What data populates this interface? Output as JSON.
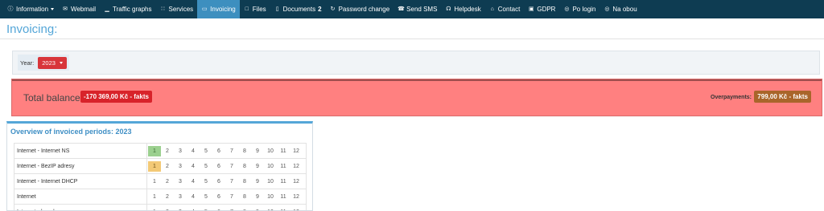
{
  "nav": {
    "items": [
      {
        "label": "Information",
        "icon": "info-icon",
        "caret": true,
        "active": false
      },
      {
        "label": "Webmail",
        "icon": "envelope-icon",
        "active": false
      },
      {
        "label": "Traffic graphs",
        "icon": "bar-chart-icon",
        "active": false
      },
      {
        "label": "Services",
        "icon": "sitemap-icon",
        "active": false
      },
      {
        "label": "Invoicing",
        "icon": "money-icon",
        "active": true
      },
      {
        "label": "Files",
        "icon": "folder-icon",
        "active": false
      },
      {
        "label": "Documents",
        "icon": "document-icon",
        "badge": "2",
        "active": false
      },
      {
        "label": "Password change",
        "icon": "refresh-icon",
        "active": false
      },
      {
        "label": "Send SMS",
        "icon": "phone-icon",
        "active": false
      },
      {
        "label": "Helpdesk",
        "icon": "helpdesk-icon",
        "active": false
      },
      {
        "label": "Contact",
        "icon": "home-icon",
        "active": false
      },
      {
        "label": "GDPR",
        "icon": "lock-icon",
        "active": false
      },
      {
        "label": "Po login",
        "icon": "globe-icon",
        "active": false
      },
      {
        "label": "Na obou",
        "icon": "globe-icon",
        "active": false
      }
    ]
  },
  "page": {
    "title": "Invoicing:"
  },
  "year_filter": {
    "label": "Year:",
    "value": "2023"
  },
  "balance": {
    "label": "Total balance:",
    "value": "-170 369,00 Kč - fakts",
    "overpayments_label": "Overpayments:",
    "overpayments_value": "799,00 Kč - fakts"
  },
  "overview": {
    "title": "Overview of invoiced periods: 2023",
    "months": [
      "1",
      "2",
      "3",
      "4",
      "5",
      "6",
      "7",
      "8",
      "9",
      "10",
      "11",
      "12"
    ],
    "rows": [
      {
        "service": "Internet - Internet NS",
        "status": {
          "1": "paid"
        }
      },
      {
        "service": "Internet - BezIP adresy",
        "status": {
          "1": "partial"
        }
      },
      {
        "service": "Internet - Internet DHCP",
        "status": {}
      },
      {
        "service": "Internet",
        "status": {}
      },
      {
        "service": "Internet - bezoku",
        "status": {}
      }
    ]
  },
  "colors": {
    "navbar": "#0e3c52",
    "nav_active": "#3d8fbf",
    "accent": "#54a6d8",
    "balance_bg": "#ff8080",
    "negative_badge": "#d8232a",
    "overpay_badge": "#a9652a",
    "paid": "#9bd08f",
    "partial": "#f3c976"
  }
}
